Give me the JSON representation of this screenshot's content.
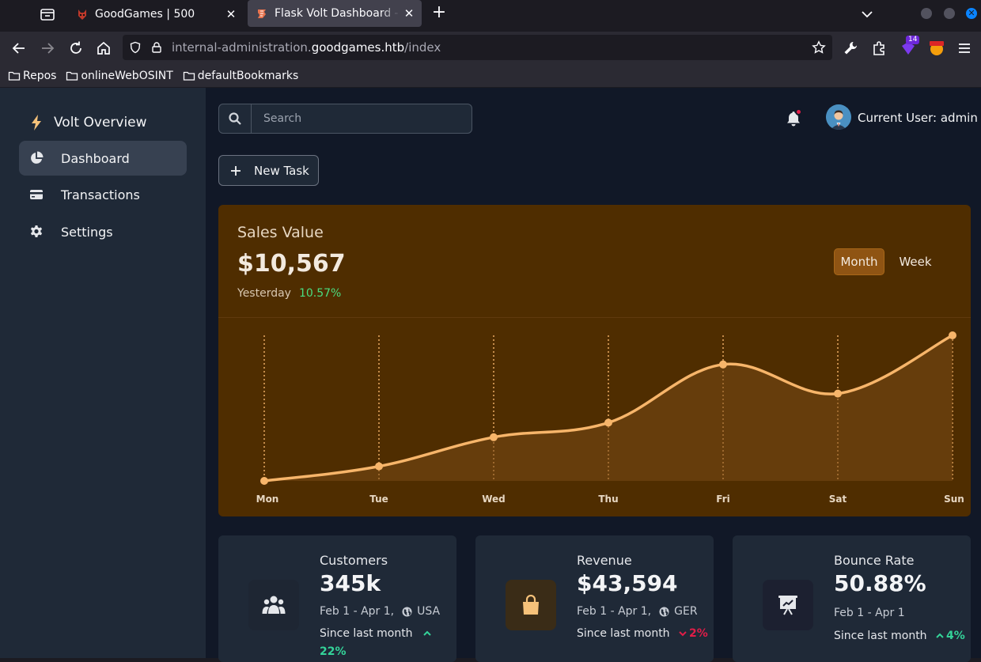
{
  "browser": {
    "tabs": [
      {
        "title": "GoodGames | 500",
        "active": false
      },
      {
        "title": "Flask Volt Dashboard - Dashboard",
        "active": true
      }
    ],
    "url_prefix": "internal-administration.",
    "url_host": "goodgames.htb",
    "url_path": "/index",
    "extension_badge": "14",
    "bookmarks": [
      "Repos",
      "onlineWebOSINT",
      "defaultBookmarks"
    ]
  },
  "sidebar": {
    "brand": "Volt Overview",
    "items": [
      {
        "label": "Dashboard",
        "icon": "pie-chart-icon",
        "active": true
      },
      {
        "label": "Transactions",
        "icon": "credit-card-icon",
        "active": false
      },
      {
        "label": "Settings",
        "icon": "gear-icon",
        "active": false
      }
    ]
  },
  "header": {
    "search_placeholder": "Search",
    "user_label": "Current User: admin",
    "new_task_label": "New Task"
  },
  "sales": {
    "title": "Sales Value",
    "value": "$10,567",
    "sub_label": "Yesterday",
    "change": "10.57%",
    "toggle_month": "Month",
    "toggle_week": "Week"
  },
  "chart_data": {
    "type": "area",
    "categories": [
      "Mon",
      "Tue",
      "Wed",
      "Thu",
      "Fri",
      "Sat",
      "Sun"
    ],
    "series": [
      {
        "values": [
          0,
          10,
          30,
          40,
          80,
          60,
          100
        ]
      }
    ],
    "ylim": [
      0,
      100
    ],
    "grid": "vertical dotted",
    "colors": {
      "line": "#f7b56a",
      "fill": "#7a4a15"
    }
  },
  "cards": [
    {
      "title": "Customers",
      "value": "345k",
      "date": "Feb 1 - Apr 1,",
      "region": "USA",
      "since": "Since last month",
      "change": "22%",
      "direction": "up",
      "icon": "users-icon"
    },
    {
      "title": "Revenue",
      "value": "$43,594",
      "date": "Feb 1 - Apr 1,",
      "region": "GER",
      "since": "Since last month",
      "change": "2%",
      "direction": "down",
      "icon": "shopping-bag-icon"
    },
    {
      "title": "Bounce Rate",
      "value": "50.88%",
      "date": "Feb 1 - Apr 1",
      "region": "",
      "since": "Since last month",
      "change": "4%",
      "direction": "up",
      "icon": "presentation-chart-icon"
    }
  ],
  "colors": {
    "sidebar_bg": "#1f2937",
    "main_bg": "#111827",
    "sales_bg": "#4f2d00",
    "accent_orange": "#f7b56a",
    "positive": "#34d399",
    "negative": "#e11d48"
  }
}
